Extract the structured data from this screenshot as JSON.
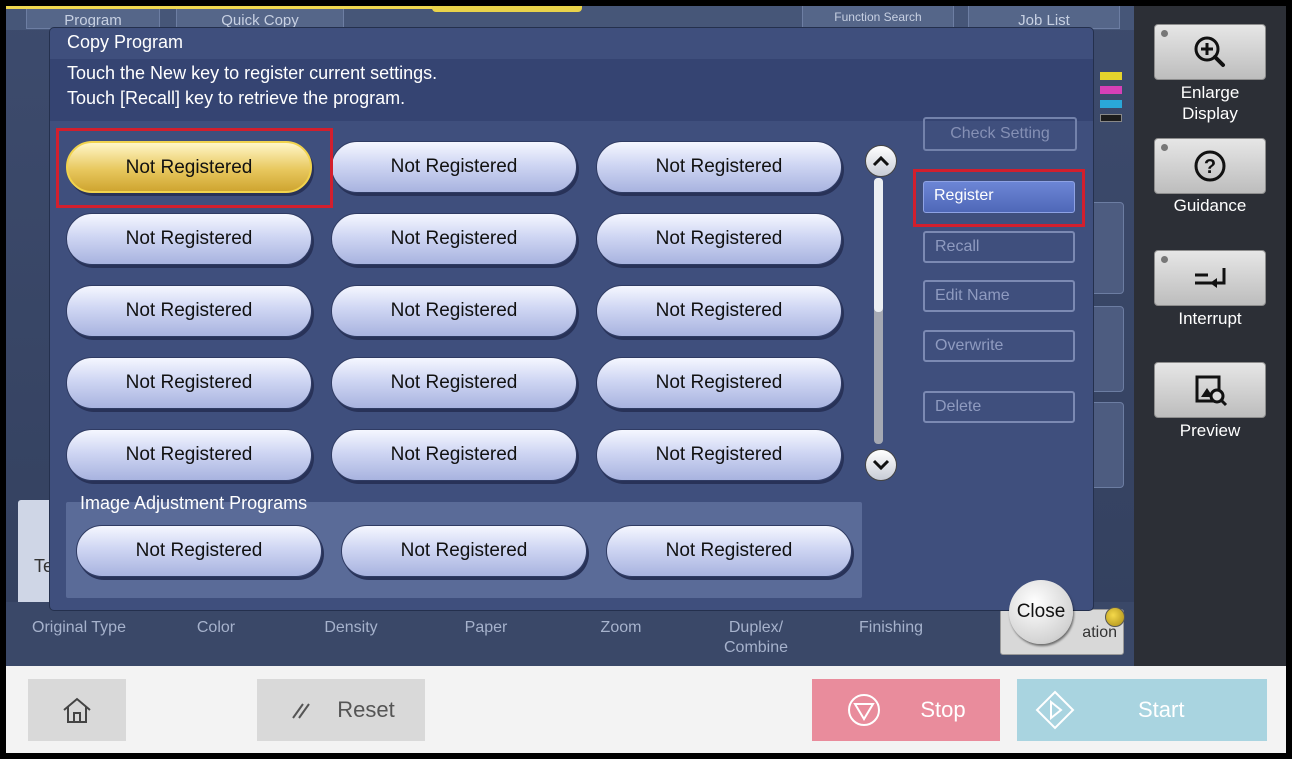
{
  "background": {
    "tabs": {
      "program": "Program",
      "quick_copy": "Quick Copy",
      "function_search": "Function Search",
      "job_list": "Job List"
    },
    "strip_labels": {
      "original_type": "Original Type",
      "color": "Color",
      "density": "Density",
      "paper": "Paper",
      "zoom": "Zoom",
      "duplex": "Duplex/",
      "combine": "Combine",
      "finishing": "Finishing"
    },
    "te_fragment": "Te",
    "application_fragment": "ation"
  },
  "dialog": {
    "title": "Copy Program",
    "message_line1": "Touch the New key to register current settings.",
    "message_line2": "Touch [Recall] key to retrieve the program.",
    "programs": [
      "Not Registered",
      "Not Registered",
      "Not Registered",
      "Not Registered",
      "Not Registered",
      "Not Registered",
      "Not Registered",
      "Not Registered",
      "Not Registered",
      "Not Registered",
      "Not Registered",
      "Not Registered",
      "Not Registered",
      "Not Registered",
      "Not Registered"
    ],
    "image_adjustment_title": "Image Adjustment Programs",
    "image_adjustment_programs": [
      "Not Registered",
      "Not Registered",
      "Not Registered"
    ],
    "actions": {
      "check_setting": "Check Setting",
      "register": "Register",
      "recall": "Recall",
      "edit_name": "Edit Name",
      "overwrite": "Overwrite",
      "delete": "Delete"
    },
    "close": "Close"
  },
  "side_panel": {
    "enlarge_display_1": "Enlarge",
    "enlarge_display_2": "Display",
    "guidance": "Guidance",
    "interrupt": "Interrupt",
    "preview": "Preview"
  },
  "bottom_bar": {
    "reset": "Reset",
    "stop": "Stop",
    "start": "Start"
  }
}
